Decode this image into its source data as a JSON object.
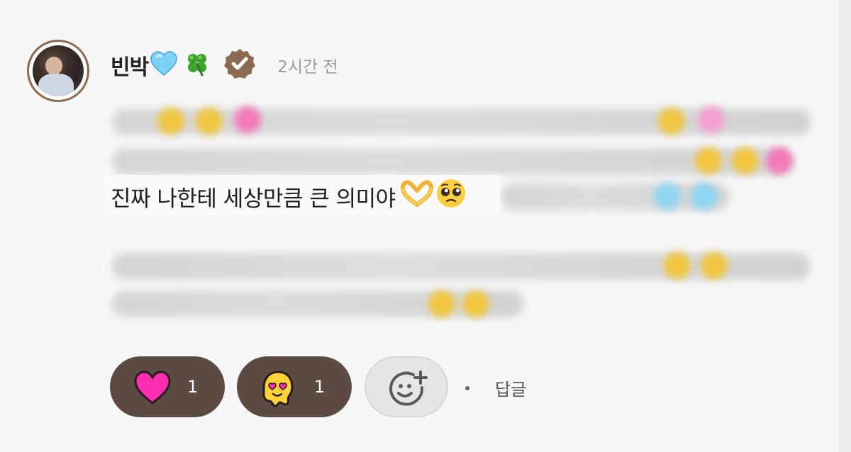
{
  "comment": {
    "username": "빈박",
    "time": "2시간 전",
    "visible_text": "진짜 나한테 세상만큼 큰 의미야",
    "name_emojis": [
      "blue-heart-icon",
      "four-leaf-clover-icon"
    ],
    "badge_icon": "verified-badge-icon",
    "trailing_emojis": [
      "heart-hands-icon",
      "pleading-face-icon"
    ]
  },
  "reactions": [
    {
      "icon": "pink-heart-icon",
      "count": "1"
    },
    {
      "icon": "melting-heart-eyes-icon",
      "count": "1"
    }
  ],
  "add_reaction_icon": "add-emoji-icon",
  "reply_label": "답글",
  "colors": {
    "reaction_bg": "#5b4b43",
    "badge": "#8a6a52",
    "heart": "#ff2fb0",
    "melt_face": "#ffd23a"
  }
}
